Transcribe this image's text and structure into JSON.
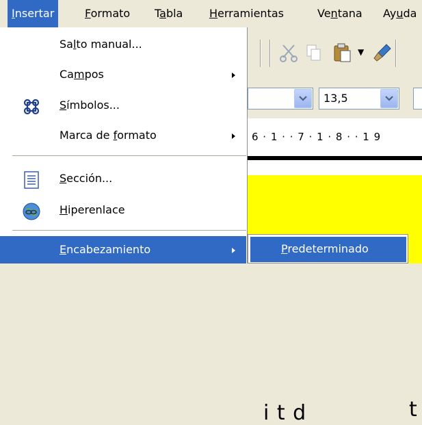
{
  "menubar": {
    "items": [
      {
        "label": "Insertar",
        "mnemonic": "I",
        "active": true
      },
      {
        "label": "Formato",
        "mnemonic": "F"
      },
      {
        "label": "Tabla",
        "mnemonic": "a"
      },
      {
        "label": "Herramientas",
        "mnemonic": "H"
      },
      {
        "label": "Ventana",
        "mnemonic": "n"
      },
      {
        "label": "Ayuda",
        "mnemonic": "u"
      }
    ]
  },
  "insert_menu": {
    "items": [
      {
        "label": "Salto manual...",
        "mnemonic": "l",
        "icon": null,
        "submenu": false
      },
      {
        "label": "Campos",
        "mnemonic": "m",
        "icon": null,
        "submenu": true
      },
      {
        "label": "Símbolos...",
        "mnemonic": "S",
        "icon": "special-character-icon",
        "submenu": false
      },
      {
        "label": "Marca de formato",
        "mnemonic": "f",
        "icon": null,
        "submenu": true
      },
      {
        "label": "Sección...",
        "mnemonic": "S",
        "icon": "section-icon",
        "submenu": false
      },
      {
        "label": "Hiperenlace",
        "mnemonic": "H",
        "icon": "hyperlink-icon",
        "submenu": false
      },
      {
        "label": "Encabezamiento",
        "mnemonic": "E",
        "icon": null,
        "submenu": true,
        "highlighted": true
      }
    ]
  },
  "header_submenu": {
    "items": [
      {
        "label": "Predeterminado",
        "mnemonic": "P",
        "highlighted": true
      }
    ]
  },
  "toolbar": {
    "font_size": "13,5"
  },
  "ruler": {
    "numbers": "6 · 1 · · 7 · 1 · 8 · · 1 9"
  },
  "document": {
    "visible_text": "i  t  d",
    "visible_text_2": "t"
  },
  "colors": {
    "menu_highlight": "#316ac5",
    "document_background": "#ffff00",
    "chrome": "#ece9d8"
  }
}
